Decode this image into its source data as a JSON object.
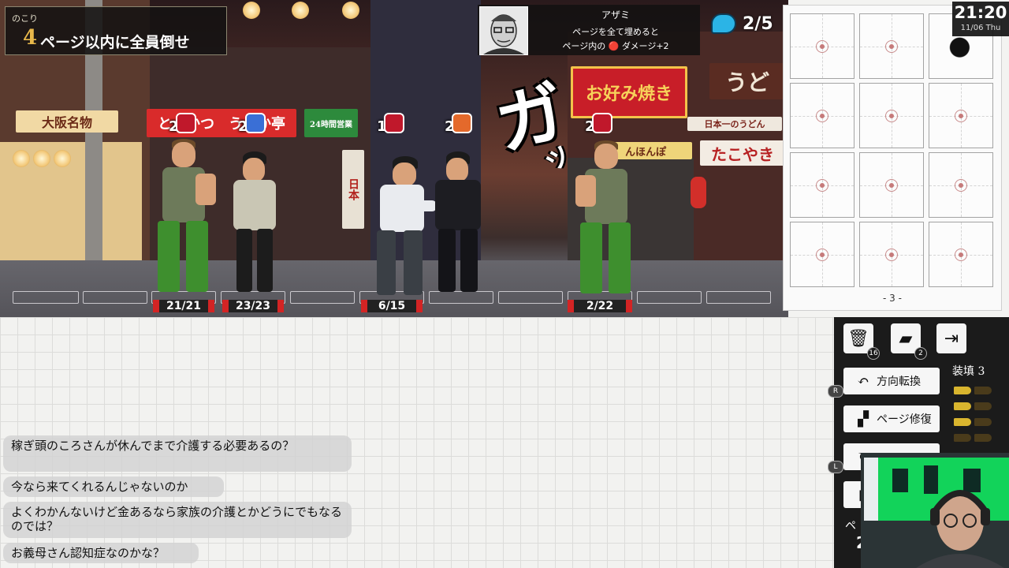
{
  "objective": {
    "label": "のこり",
    "count": "4",
    "text": "ページ以内に全員倒せ"
  },
  "boss": {
    "name": "アザミ",
    "line1": "ページを全て埋めると",
    "line2": "ページ内の 🔴 ダメージ+2"
  },
  "energy": {
    "value": "2/5"
  },
  "clock": {
    "time": "21:20",
    "date": "11/06 Thu"
  },
  "scene_signs": {
    "osaka": "大阪名物",
    "tonkatsu": "とんかつ　うまか亭",
    "open24": "24時間営業",
    "okonomiyaki": "お好み焼き",
    "udon": "うど",
    "udon_sub": "日本一のうどん",
    "takoyaki": "たこやき",
    "nihon": "日本",
    "honpo": "んほんぽ"
  },
  "sfx": {
    "main": "ガ",
    "tail": "ッ"
  },
  "fighters": [
    {
      "name": "thug-left",
      "hp": "21/21",
      "intent": "2",
      "intent_color": "#c0182b"
    },
    {
      "name": "hooded",
      "hp": "23/23",
      "intent": "2",
      "intent_color": "#3a6fd6"
    },
    {
      "name": "player",
      "hp": "6/15",
      "intent": "1",
      "intent_color": "#c0182b"
    },
    {
      "name": "suit",
      "hp": "",
      "intent": "2",
      "intent_color": "#e4692b"
    },
    {
      "name": "thug-right",
      "hp": "2/22",
      "intent": "2",
      "intent_color": "#c0182b"
    }
  ],
  "page_panel": {
    "page_number": "- 3 -"
  },
  "sidebar": {
    "discard_badge": "16",
    "deck_badge": "2",
    "turn_button": "方向転換",
    "repair_button": "ページ修復",
    "ammo_label": "装填 3",
    "key_r": "R",
    "key_l": "L",
    "side_chars": "ペ",
    "side_num": "2"
  },
  "chat": [
    "稼ぎ頭のころさんが休んでまで介護する必要あるの？",
    "今なら来てくれるんじゃないのか",
    "よくわかんないけど金あるなら家族の介護とかどうにでもなるのでは？",
    "お義母さん認知症なのかな？"
  ]
}
